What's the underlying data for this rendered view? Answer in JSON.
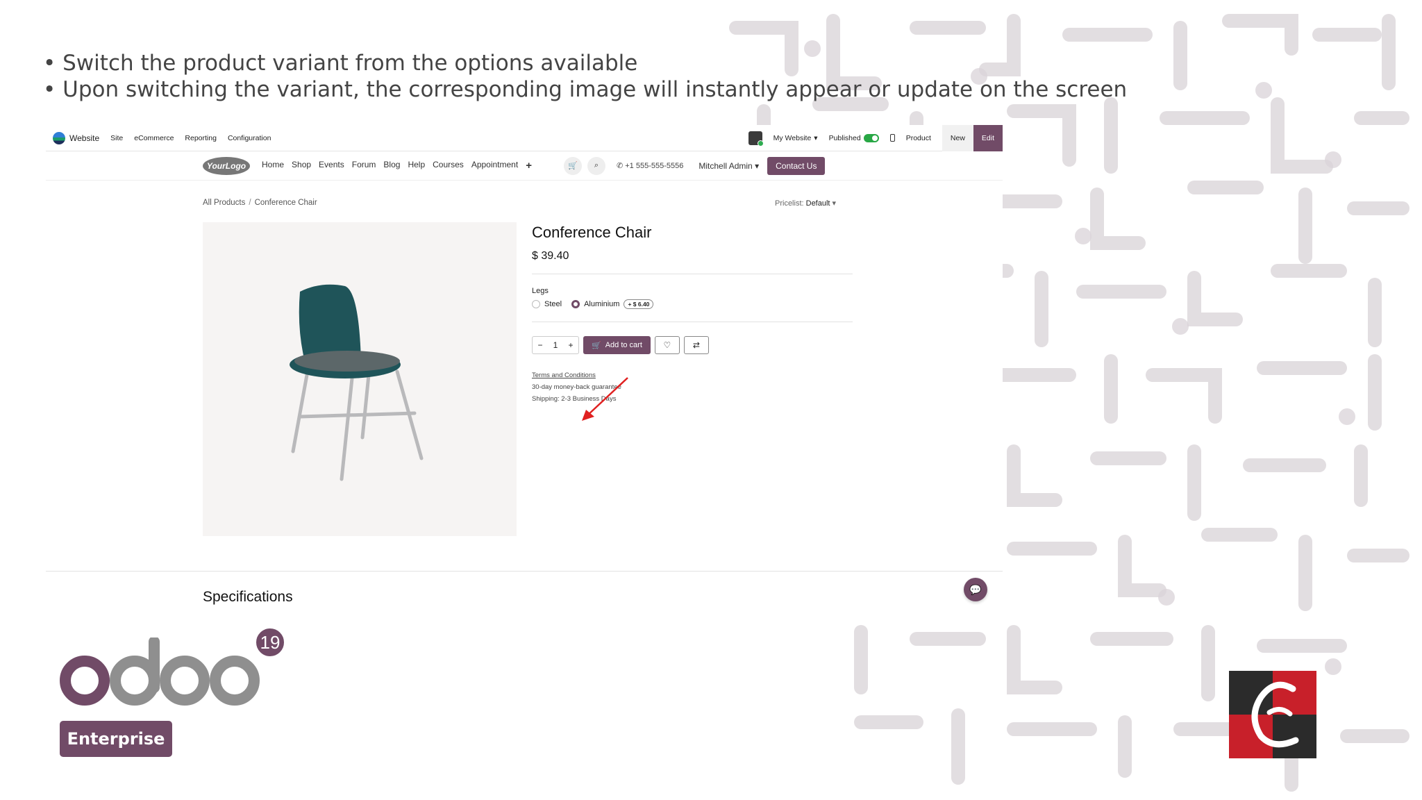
{
  "slide": {
    "bullets": [
      "Switch the product variant from the options available",
      "Upon switching the variant, the corresponding image will instantly appear or update on the screen"
    ]
  },
  "topbar": {
    "app": "Website",
    "menu": [
      "Site",
      "eCommerce",
      "Reporting",
      "Configuration"
    ],
    "my_website": "My Website",
    "published": "Published",
    "product": "Product",
    "new": "New",
    "edit": "Edit"
  },
  "sitenav": {
    "logo": "YourLogo",
    "links": [
      "Home",
      "Shop",
      "Events",
      "Forum",
      "Blog",
      "Help",
      "Courses",
      "Appointment"
    ],
    "phone": "+1 555-555-5556",
    "user": "Mitchell Admin",
    "contact": "Contact Us"
  },
  "breadcrumb": {
    "root": "All Products",
    "sep": "/",
    "current": "Conference Chair"
  },
  "pricelist": {
    "label": "Pricelist:",
    "value": "Default"
  },
  "product": {
    "title": "Conference Chair",
    "price": "$ 39.40",
    "attribute": "Legs",
    "variants": [
      {
        "label": "Steel",
        "selected": false
      },
      {
        "label": "Aluminium",
        "selected": true,
        "extra": "+ $ 6.40"
      }
    ],
    "quantity": "1",
    "add_to_cart": "Add to cart",
    "terms": "Terms and Conditions",
    "guarantee": "30-day money-back guarantee",
    "shipping": "Shipping: 2-3 Business Days"
  },
  "specifications": "Specifications",
  "branding": {
    "odoo_version": "19",
    "edition": "Enterprise"
  },
  "colors": {
    "accent": "#714b67",
    "published_toggle": "#28a745",
    "arrow": "#e02020"
  }
}
